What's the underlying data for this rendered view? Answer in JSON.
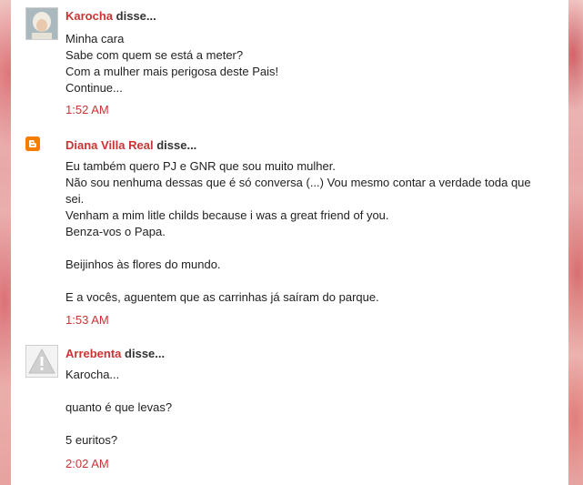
{
  "comments": [
    {
      "author": "Karocha",
      "said": "disse...",
      "lines": [
        "Minha cara",
        "Sabe com quem se está a meter?",
        "Com a mulher mais perigosa deste Pais!",
        "Continue..."
      ],
      "time": "1:52 AM",
      "avatar_icon": "user-photo-icon"
    },
    {
      "author": "Diana Villa Real",
      "said": "disse...",
      "lines": [
        "Eu também quero PJ e GNR que sou muito mulher.",
        "Não sou nenhuma dessas que é só conversa (...) Vou mesmo contar a verdade toda que sei.",
        "Venham a mim litle childs because i was a great friend of you.",
        "Benza-vos o Papa.",
        "",
        "Beijinhos às flores do mundo.",
        "",
        "E a vocês, aguentem que as carrinhas já saíram do parque."
      ],
      "time": "1:53 AM",
      "avatar_icon": "blogger-icon"
    },
    {
      "author": "Arrebenta",
      "said": "disse...",
      "lines": [
        "Karocha...",
        "",
        "quanto é que levas?",
        "",
        "5 euritos?"
      ],
      "time": "2:02 AM",
      "avatar_icon": "default-avatar-icon"
    }
  ],
  "colors": {
    "link": "#cc3333",
    "text": "#222222",
    "blogger": "#f57d00"
  }
}
